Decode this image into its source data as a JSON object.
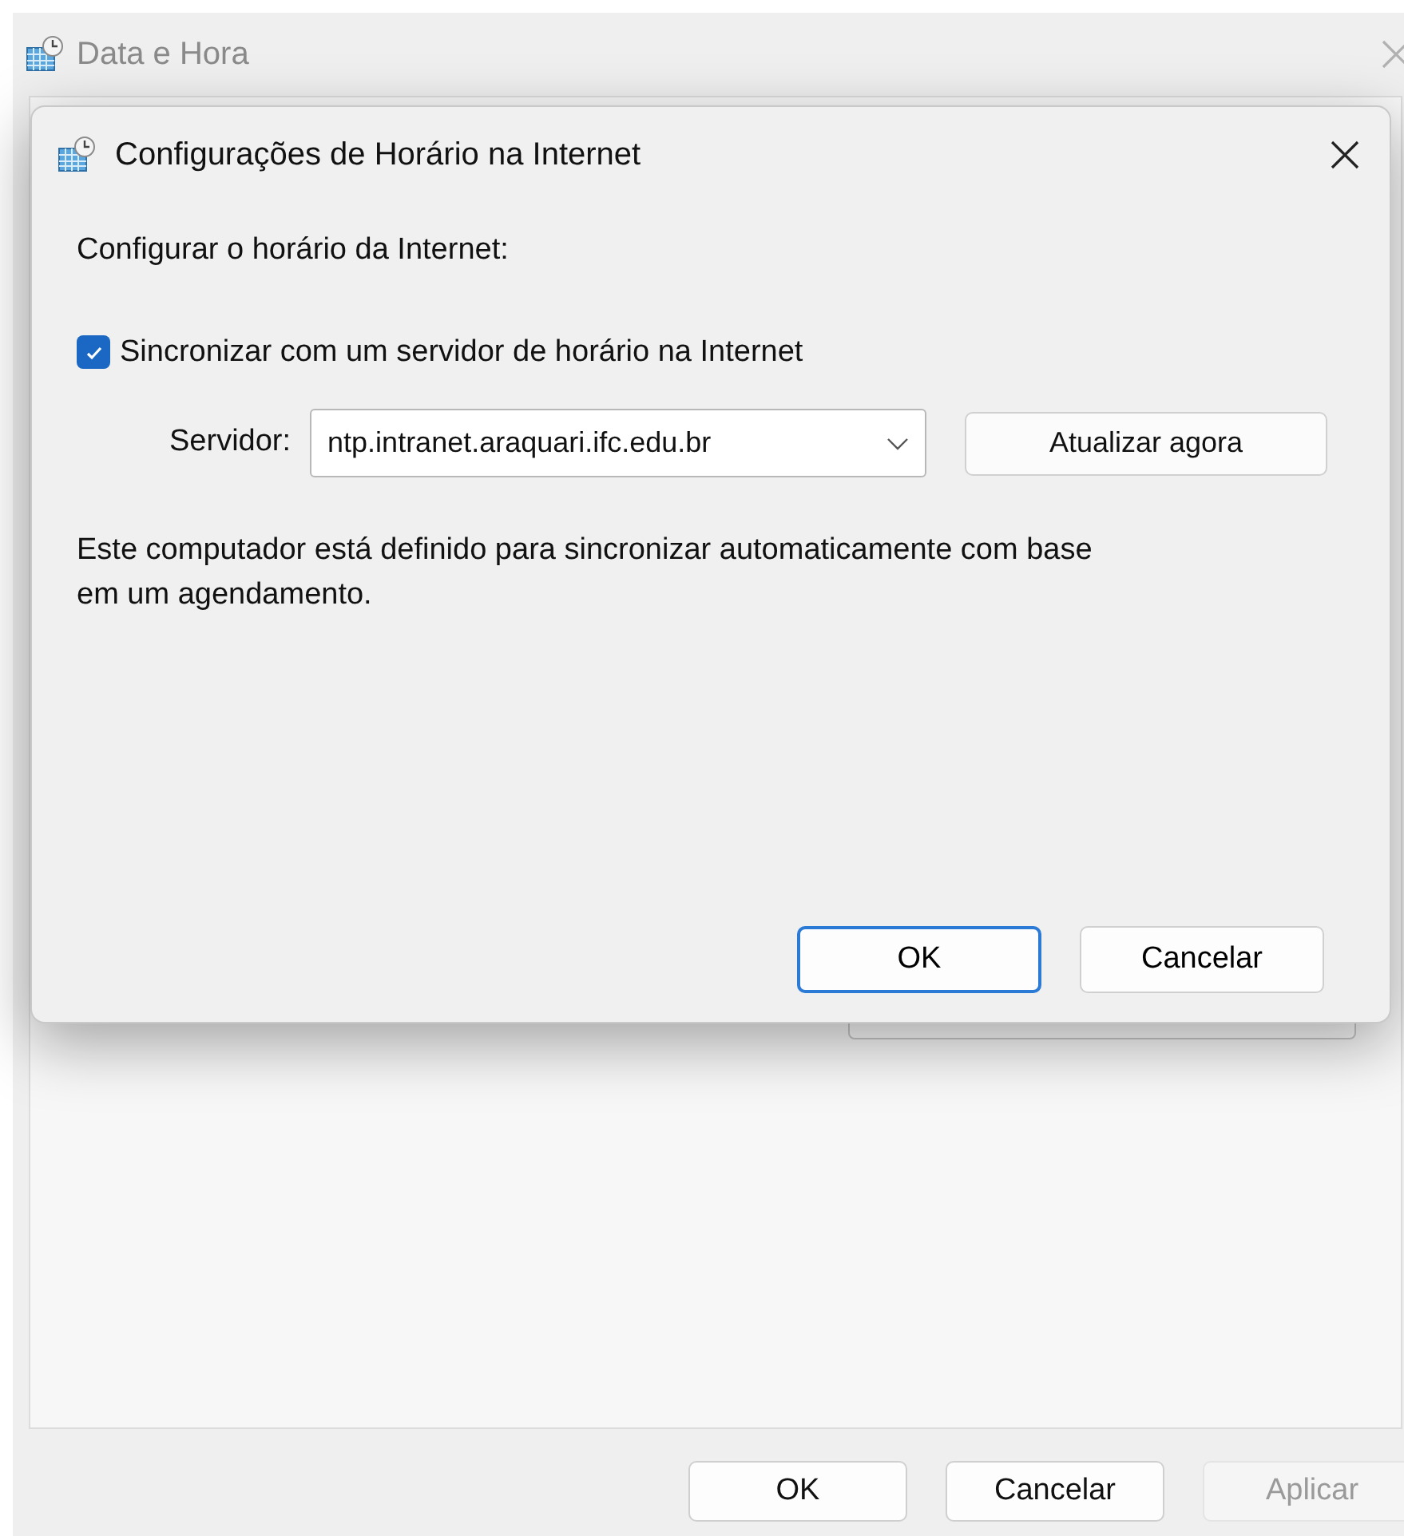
{
  "window": {
    "title": "Data e Hora",
    "buttons": [
      {
        "label": "OK",
        "disabled": false
      },
      {
        "label": "Cancelar",
        "disabled": false
      },
      {
        "label": "Aplicar",
        "disabled": true
      }
    ]
  },
  "dialog": {
    "title": "Configurações de Horário na Internet",
    "heading": "Configurar o horário da Internet:",
    "sync": {
      "label": "Sincronizar com um servidor de horário na Internet",
      "checked": true
    },
    "server": {
      "label": "Servidor:",
      "value": "ntp.intranet.araquari.ifc.edu.br"
    },
    "update_button": "Atualizar agora",
    "message": "Este computador está definido para sincronizar automaticamente com base em um agendamento.",
    "buttons": [
      {
        "label": "OK",
        "default": true
      },
      {
        "label": "Cancelar",
        "default": false
      }
    ]
  }
}
